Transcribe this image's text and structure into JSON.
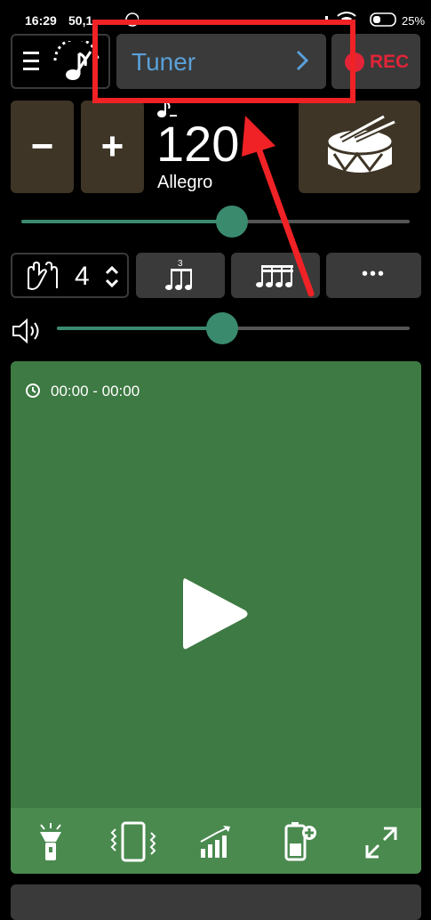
{
  "status_bar": {
    "time": "16:29",
    "signal_text": "50,1",
    "battery_percent": "25%"
  },
  "top_bar": {
    "tuner_label": "Tuner",
    "rec_label": "REC"
  },
  "tempo": {
    "minus_label": "−",
    "plus_label": "+",
    "bpm": "120",
    "name": "Allegro",
    "tempo_slider_fraction": 0.5
  },
  "beats": {
    "count": "4",
    "more_label": "•••"
  },
  "volume": {
    "slider_fraction": 0.47
  },
  "player": {
    "timer_text": "00:00 - 00:00"
  },
  "colors": {
    "accent_green": "#3a8a6e",
    "panel_green": "#3e7a43",
    "rec_red": "#e32438",
    "tuner_blue": "#5aa0d8",
    "annotation_red": "#f02226"
  },
  "icons": {
    "menu": "hamburger-icon",
    "metronome": "metronome-note-icon",
    "chevron": "chevron-right-icon",
    "drum": "drum-icon",
    "hands": "clapping-hands-icon",
    "triplet": "triplet-note-icon",
    "sixteenth": "sixteenth-notes-icon",
    "volume": "speaker-icon",
    "clock": "clock-icon",
    "play": "play-icon",
    "flashlight": "flashlight-icon",
    "vibrate": "vibrate-icon",
    "increase": "tempo-increase-icon",
    "battery": "battery-saver-icon",
    "fullscreen": "fullscreen-icon"
  }
}
